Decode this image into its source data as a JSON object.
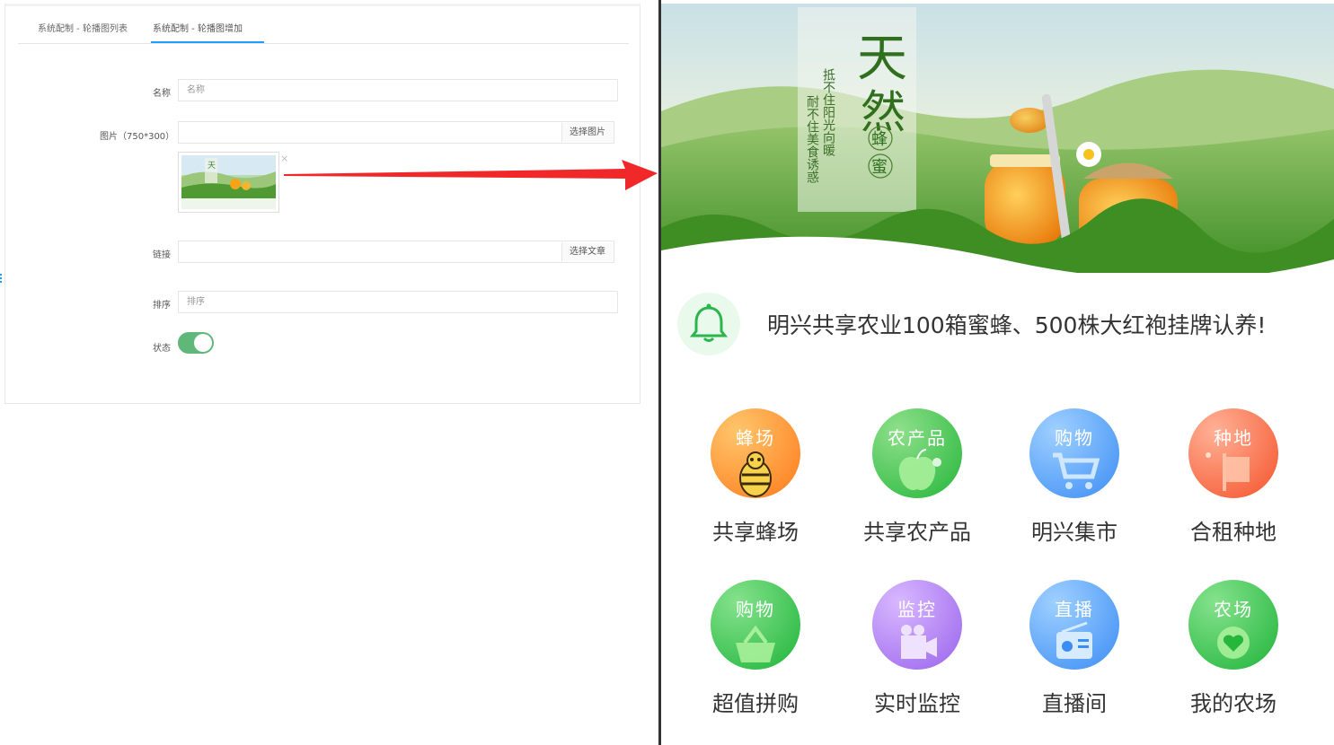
{
  "admin": {
    "tabs": [
      {
        "label": "系统配制 - 轮播图列表"
      },
      {
        "label": "系统配制 - 轮播图增加"
      }
    ],
    "fields": {
      "name": {
        "label": "名称",
        "placeholder": "名称"
      },
      "image": {
        "label": "图片（750*300）",
        "button": "选择图片",
        "close": "×"
      },
      "link": {
        "label": "链接",
        "button": "选择文章"
      },
      "sort": {
        "label": "排序",
        "placeholder": "排序"
      },
      "status": {
        "label": "状态",
        "on": true
      }
    }
  },
  "app": {
    "banner": {
      "title_chars": [
        "天",
        "然"
      ],
      "subtitle_chars": [
        "蜂",
        "蜜"
      ],
      "poem_line_1": "抵不住阳光向暖",
      "poem_line_2": "耐不住美食诱惑"
    },
    "notice": {
      "icon": "bell-icon",
      "text": "明兴共享农业100箱蜜蜂、500株大红袍挂牌认养!"
    },
    "menu": [
      {
        "title": "蜂场",
        "label": "共享蜂场",
        "icon": "bee-icon",
        "color_a": "#ffc56b",
        "color_b": "#ff7a1a"
      },
      {
        "title": "农产品",
        "label": "共享农产品",
        "icon": "apple-icon",
        "color_a": "#8ee08a",
        "color_b": "#25b63a"
      },
      {
        "title": "购物",
        "label": "明兴集市",
        "icon": "cart-icon",
        "color_a": "#9fd0ff",
        "color_b": "#3b8df5"
      },
      {
        "title": "种地",
        "label": "合租种地",
        "icon": "flag-icon",
        "color_a": "#ffb196",
        "color_b": "#f5522a"
      },
      {
        "title": "购物",
        "label": "超值拼购",
        "icon": "basket-icon",
        "color_a": "#85e28c",
        "color_b": "#1fb43a"
      },
      {
        "title": "监控",
        "label": "实时监控",
        "icon": "camera-icon",
        "color_a": "#d8b8ff",
        "color_b": "#9a63ec"
      },
      {
        "title": "直播",
        "label": "直播间",
        "icon": "radio-icon",
        "color_a": "#9fd0ff",
        "color_b": "#3b8df5"
      },
      {
        "title": "农场",
        "label": "我的农场",
        "icon": "heart-icon",
        "color_a": "#85e28c",
        "color_b": "#1fb43a"
      }
    ]
  },
  "colors": {
    "tab_active": "#1e9fff",
    "toggle_on": "#5fb878",
    "arrow": "#f0282a",
    "notice_icon": "#2bb54d"
  }
}
